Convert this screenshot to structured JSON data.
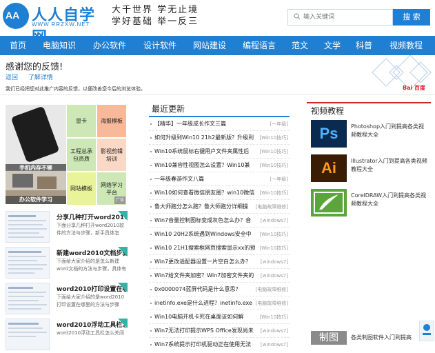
{
  "header": {
    "logo_badge": "AA",
    "logo_name": "人人自学网",
    "logo_url": "WWW.RRZXW.NET",
    "slogan_line1": "大千世界 学无止境",
    "slogan_line2": "学好基础 举一反三",
    "search_placeholder": "输入关键词",
    "search_button": "搜 索"
  },
  "nav": {
    "items": [
      "首页",
      "电脑知识",
      "办公软件",
      "设计软件",
      "网站建设",
      "编程语言",
      "范文",
      "文学",
      "科普",
      "视频教程"
    ]
  },
  "notice": {
    "title": "感谢您的反馈!",
    "link_back": "返回",
    "link_detail": "了解详情",
    "desc": "我们已经把您对此推广内容的反馈，以便改善您今后的浏览体验。",
    "brand": "Bai 百度"
  },
  "tiles": {
    "phone_caption": "手机内存不够",
    "desk_caption": "办公软件学习",
    "items": [
      {
        "label": "显卡",
        "color": "#cde8b6"
      },
      {
        "label": "海报模板",
        "color": "#f7b99a"
      },
      {
        "label": "工程总承包资质",
        "color": "#cde8b6"
      },
      {
        "label": "影视剪辑培训",
        "color": "#f9d8c6"
      },
      {
        "label": "网站模板",
        "color": "#e9f39a"
      },
      {
        "label": "网络学习平台",
        "color": "#cde8b6"
      }
    ],
    "ad_tag": "广告"
  },
  "articles": [
    {
      "title": "分享几种打开word2010",
      "desc": "下面分享几种打开word2010软件的方法与步骤，新手具体怎"
    },
    {
      "title": "新建word2010文档步骤",
      "desc": "下面给大家介绍的是怎么新建word文档的方法与步骤，具体有"
    },
    {
      "title": "word2010打印设置在哪",
      "desc": "下面给大家介绍的是word2010打印设置在哪里的方法与步骤"
    },
    {
      "title": "word2010浮动工具栏怎",
      "desc": "word2010浮动工具栏怎么关闭"
    }
  ],
  "latest": {
    "title": "最近更新",
    "items": [
      {
        "title": "【精华】一年级成长作文三篇",
        "cat": "[一年级]"
      },
      {
        "title": "如何升级到Win10 21h2最新版？升级到",
        "cat": "[Win10技巧]"
      },
      {
        "title": "Win10系统鼠标右键用户文件夹属性后",
        "cat": "[Win10技巧]"
      },
      {
        "title": "Win10兼容性视图怎么设置？Win10兼",
        "cat": "[Win10技巧]"
      },
      {
        "title": "一年级春游作文八篇",
        "cat": "[一年级]"
      },
      {
        "title": "Win10如何查看微信朋友圈？win10微信",
        "cat": "[Win10技巧]"
      },
      {
        "title": "鲁大师跑分怎么跑？鲁大师跑分详细操",
        "cat": "[电脑故障维修]"
      },
      {
        "title": "Win7音量控制图标变成灰色怎么办？音",
        "cat": "[windows7]"
      },
      {
        "title": "Win10 20H2系统遇到Windows安全中",
        "cat": "[Win10技巧]"
      },
      {
        "title": "Win10 21H1搜索框网页搜索显示xx的预",
        "cat": "[Win10技巧]"
      },
      {
        "title": "Win7更改适配器设置一片空白怎么办？",
        "cat": "[windows7]"
      },
      {
        "title": "Win7给文件夹加密？Win7加密文件夹的",
        "cat": "[windows7]"
      },
      {
        "title": "0x0000074蓝屏代码是什么意思？",
        "cat": "[电脑故障维修]"
      },
      {
        "title": "inetinfo.exe是什么进程？inetinfo.exe",
        "cat": "[电脑故障维修]"
      },
      {
        "title": "Win10电脑开机卡死在桌面该如何解",
        "cat": "[Win10技巧]"
      },
      {
        "title": "Win7无法打印提示WPS Office发现尚未",
        "cat": "[windows7]"
      },
      {
        "title": "Win7系统提示打印机驱动正在使用无法",
        "cat": "[windows7]"
      }
    ]
  },
  "videos": {
    "title": "视频教程",
    "items": [
      {
        "icon": "Ps",
        "color": "#0b2a4f",
        "text": "Photoshop入门到提高各类视频教程大全"
      },
      {
        "icon": "Ai",
        "color": "#3b1c05",
        "text": "Illustrator入门到提高各类视频教程大全"
      },
      {
        "icon": "",
        "color": "#5aa63a",
        "text": "CorelDRAW入门到提高各类视频教程大全"
      }
    ],
    "gray_block": "制图",
    "gray_text": "各类制图软件入门到提高"
  }
}
